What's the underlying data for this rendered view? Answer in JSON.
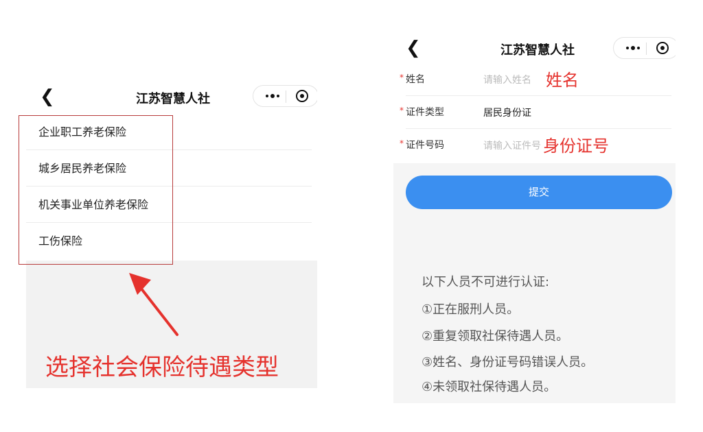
{
  "left_screen": {
    "app_title": "江苏智慧人社",
    "menu_items": [
      {
        "label": "企业职工养老保险"
      },
      {
        "label": "城乡居民养老保险"
      },
      {
        "label": "机关事业单位养老保险"
      },
      {
        "label": "工伤保险"
      }
    ],
    "caption": "选择社会保险待遇类型"
  },
  "right_screen": {
    "app_title": "江苏智慧人社",
    "form": {
      "name": {
        "required_mark": "*",
        "label": "姓名",
        "placeholder": "请输入姓名",
        "annotation": "姓名"
      },
      "id_type": {
        "required_mark": "*",
        "label": "证件类型",
        "value": "居民身份证"
      },
      "id_number": {
        "required_mark": "*",
        "label": "证件号码",
        "placeholder": "请输入证件号",
        "annotation": "身份证号"
      }
    },
    "submit_label": "提交",
    "notice": {
      "heading": "以下人员不可进行认证:",
      "items": [
        "①正在服刑人员。",
        "②重复领取社保待遇人员。",
        "③姓名、身份证号码错误人员。",
        "④未领取社保待遇人员。"
      ]
    }
  },
  "colors": {
    "annotation_red": "#e5322d",
    "box_red": "#b73a3a",
    "submit_blue": "#3b8ff0"
  },
  "icons": [
    "back-arrow-icon",
    "more-dots-icon",
    "close-target-icon",
    "red-arrow-icon"
  ]
}
